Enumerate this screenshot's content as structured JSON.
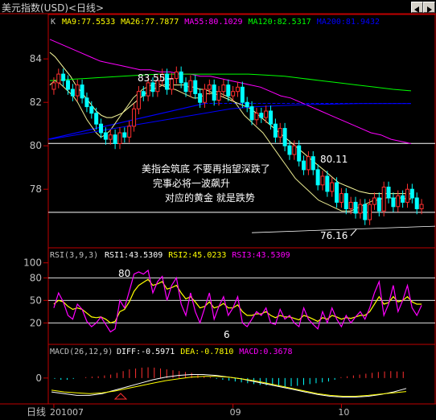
{
  "window": {
    "title": "美元指数(USD)<日线>"
  },
  "chart_data": [
    {
      "type": "candlestick",
      "panel": "main",
      "ma_header": {
        "prefix": "K",
        "items": [
          {
            "text": "MA9:77.5533",
            "color": "#ffff00"
          },
          {
            "text": "MA26:77.7877",
            "color": "#ffff00"
          },
          {
            "text": "MA55:80.1029",
            "color": "#ff00ff"
          },
          {
            "text": "MA120:82.5317",
            "color": "#00ff00"
          },
          {
            "text": "MA200:81.9432",
            "color": "#0000ff"
          }
        ]
      },
      "y_ticks": [
        84,
        82,
        80,
        78
      ],
      "ylim": [
        75.6,
        85.6
      ],
      "hlines": [
        80.11,
        76.94
      ],
      "annotations": {
        "high": "83.55",
        "mid": "80.11",
        "low": "76.16",
        "comment": [
          "美指会筑底 不要再指望深跌了",
          "完事必将一波飙升",
          "对应的黄金 就是跌势"
        ]
      },
      "closes": [
        82.9,
        83.3,
        83.0,
        82.6,
        82.3,
        82.8,
        82.2,
        81.8,
        81.5,
        81.0,
        80.6,
        80.3,
        80.5,
        80.1,
        80.6,
        80.4,
        80.9,
        81.7,
        82.5,
        82.3,
        82.9,
        82.5,
        83.0,
        83.3,
        82.6,
        83.1,
        83.4,
        82.9,
        82.5,
        83.0,
        82.4,
        82.0,
        82.6,
        82.8,
        82.1,
        82.5,
        82.8,
        82.3,
        82.5,
        82.7,
        82.0,
        81.8,
        81.2,
        81.5,
        81.3,
        81.6,
        81.0,
        80.4,
        80.8,
        80.0,
        79.6,
        80.0,
        79.3,
        78.9,
        79.5,
        78.9,
        78.2,
        78.6,
        77.9,
        78.3,
        77.4,
        77.8,
        77.1,
        77.4,
        76.9,
        77.3,
        76.6,
        77.3,
        77.6,
        77.0,
        78.1,
        77.6,
        77.2,
        77.7,
        77.4,
        78.0,
        77.6,
        77.1,
        77.3
      ],
      "ma_series": [
        {
          "name": "MA9",
          "color": "#e8e890",
          "values": [
            82.8,
            83.0,
            82.9,
            82.7,
            82.5,
            82.3,
            82.0,
            81.6,
            81.2,
            80.9,
            80.6,
            80.4,
            80.5,
            80.7,
            81.0,
            81.3,
            81.6,
            81.9,
            82.2,
            82.4,
            82.6,
            82.7,
            82.8,
            82.9,
            82.8,
            82.7,
            82.6,
            82.6,
            82.5,
            82.4,
            82.3,
            82.2,
            82.2,
            82.3,
            82.4,
            82.4,
            82.5,
            82.4,
            82.3,
            82.2,
            82.0,
            81.7,
            81.4,
            81.2,
            81.0,
            80.8,
            80.6,
            80.3,
            80.0,
            79.7,
            79.4,
            79.1,
            78.8,
            78.5,
            78.3,
            78.1,
            77.9,
            77.7,
            77.5,
            77.4,
            77.3,
            77.2,
            77.1,
            77.0,
            77.0,
            77.0,
            77.1,
            77.2,
            77.3,
            77.4,
            77.5,
            77.5,
            77.6,
            77.6,
            77.6,
            77.6,
            77.6,
            77.55,
            77.55
          ]
        },
        {
          "name": "MA26",
          "color": "#ffffa0",
          "values": [
            84.3,
            84.1,
            83.8,
            83.5,
            83.2,
            82.8,
            82.5,
            82.2,
            81.9,
            81.6,
            81.4,
            81.3,
            81.3,
            81.4,
            81.5,
            81.7,
            81.9,
            82.1,
            82.3,
            82.5,
            82.6,
            82.7,
            82.8,
            82.8,
            82.8,
            82.8,
            82.8,
            82.7,
            82.7,
            82.6,
            82.6,
            82.5,
            82.4,
            82.3,
            82.2,
            82.1,
            82.0,
            81.9,
            81.8,
            81.7,
            81.5,
            81.3,
            81.1,
            80.9,
            80.7,
            80.5,
            80.3,
            80.1,
            79.9,
            79.7,
            79.5,
            79.3,
            79.1,
            78.9,
            78.7,
            78.5,
            78.3,
            78.2,
            78.1,
            78.0,
            77.9,
            77.85,
            77.8,
            77.8,
            77.8,
            77.8,
            77.8,
            77.8,
            77.8,
            77.8,
            77.79
          ]
        },
        {
          "name": "MA55",
          "color": "#ff00ff",
          "values": [
            84.9,
            84.7,
            84.5,
            84.3,
            84.1,
            83.9,
            83.8,
            83.7,
            83.6,
            83.5,
            83.5,
            83.4,
            83.4,
            83.3,
            83.3,
            83.2,
            83.2,
            83.1,
            83.0,
            82.9,
            82.8,
            82.7,
            82.5,
            82.3,
            82.2,
            82.0,
            81.8,
            81.6,
            81.4,
            81.2,
            81.0,
            80.8,
            80.6,
            80.5,
            80.3,
            80.2,
            80.1
          ]
        },
        {
          "name": "MA120",
          "color": "#00ff00",
          "values": [
            83.0,
            83.05,
            83.1,
            83.15,
            83.2,
            83.25,
            83.3,
            83.3,
            83.3,
            83.3,
            83.3,
            83.3,
            83.25,
            83.2,
            83.1,
            83.0,
            82.9,
            82.8,
            82.7,
            82.6,
            82.53
          ]
        },
        {
          "name": "MA200",
          "color": "#0000ff",
          "values": [
            80.3,
            80.5,
            80.7,
            80.9,
            81.1,
            81.3,
            81.5,
            81.7,
            81.8,
            81.85,
            81.9,
            81.92,
            81.94,
            81.94,
            81.94
          ]
        }
      ]
    },
    {
      "type": "line",
      "panel": "RSI",
      "header": {
        "prefix": "RSI(3,9,3)",
        "items": [
          {
            "text": "RSI1:43.5309",
            "color": "#ffffff"
          },
          {
            "text": "RSI2:45.0233",
            "color": "#ffff00"
          },
          {
            "text": "RSI3:43.5309",
            "color": "#ff00ff"
          }
        ]
      },
      "y_ticks": [
        100,
        80,
        50,
        20
      ],
      "ylim": [
        0,
        105
      ],
      "hlines": [
        80,
        50,
        20
      ],
      "annotations": {
        "high": "80",
        "low": "6"
      },
      "series": [
        {
          "name": "RSI1",
          "color": "#ff00ff",
          "values": [
            40,
            60,
            48,
            30,
            25,
            45,
            38,
            22,
            15,
            20,
            28,
            18,
            8,
            12,
            50,
            40,
            62,
            85,
            88,
            85,
            90,
            60,
            75,
            82,
            50,
            70,
            80,
            45,
            30,
            60,
            35,
            20,
            40,
            60,
            25,
            42,
            55,
            30,
            40,
            55,
            20,
            15,
            25,
            35,
            30,
            40,
            20,
            18,
            38,
            25,
            30,
            20,
            15,
            40,
            25,
            18,
            12,
            35,
            20,
            40,
            25,
            15,
            30,
            20,
            28,
            35,
            25,
            40,
            60,
            75,
            30,
            45,
            70,
            35,
            50,
            70,
            40,
            30,
            43.5
          ]
        },
        {
          "name": "RSI2",
          "color": "#ffff00",
          "values": [
            45,
            50,
            48,
            42,
            38,
            40,
            38,
            33,
            28,
            27,
            28,
            25,
            20,
            22,
            35,
            38,
            48,
            62,
            70,
            74,
            78,
            70,
            72,
            75,
            65,
            67,
            70,
            60,
            52,
            55,
            48,
            40,
            42,
            48,
            40,
            42,
            46,
            40,
            40,
            44,
            35,
            30,
            30,
            32,
            32,
            35,
            30,
            27,
            30,
            28,
            28,
            26,
            24,
            30,
            28,
            25,
            22,
            27,
            25,
            30,
            28,
            25,
            27,
            26,
            28,
            30,
            30,
            35,
            45,
            55,
            45,
            47,
            55,
            48,
            50,
            55,
            48,
            45,
            45
          ]
        }
      ]
    },
    {
      "type": "bar",
      "panel": "MACD",
      "header": {
        "prefix": "MACD(26,12,9)",
        "items": [
          {
            "text": "DIFF:-0.5971",
            "color": "#ffffff"
          },
          {
            "text": "DEA:-0.7810",
            "color": "#ffff00"
          },
          {
            "text": "MACD:0.3678",
            "color": "#ff00ff"
          }
        ]
      },
      "y_ticks": [
        0
      ],
      "ylim": [
        -1.4,
        1.2
      ],
      "macd": [
        -0.05,
        -0.1,
        -0.1,
        -0.05,
        0,
        0.05,
        0.08,
        0.1,
        0.15,
        0.2,
        0.3,
        0.4,
        0.5,
        0.55,
        0.6,
        0.62,
        0.6,
        0.55,
        0.5,
        0.45,
        0.4,
        0.35,
        0.3,
        0.2,
        0.1,
        0.05,
        -0.05,
        -0.1,
        -0.15,
        -0.2,
        -0.25,
        -0.3,
        -0.35,
        -0.4,
        -0.42,
        -0.45,
        -0.48,
        -0.5,
        -0.48,
        -0.45,
        -0.4,
        -0.35,
        -0.3,
        -0.25,
        -0.2,
        -0.1,
        0.05,
        0.1,
        0.15,
        0.2,
        0.25,
        0.3,
        0.35,
        0.38,
        0.4,
        0.38,
        0.37
      ],
      "diff": [
        -0.8,
        -0.9,
        -1.0,
        -1.0,
        -0.9,
        -0.7,
        -0.5,
        -0.3,
        -0.1,
        0.05,
        0.15,
        0.2,
        0.2,
        0.15,
        0.05,
        -0.05,
        -0.2,
        -0.35,
        -0.5,
        -0.65,
        -0.8,
        -0.95,
        -1.05,
        -1.1,
        -1.1,
        -1.05,
        -0.95,
        -0.8,
        -0.6
      ],
      "dea": [
        -0.7,
        -0.8,
        -0.85,
        -0.9,
        -0.85,
        -0.75,
        -0.6,
        -0.45,
        -0.3,
        -0.15,
        -0.05,
        0.05,
        0.1,
        0.1,
        0.05,
        -0.05,
        -0.15,
        -0.3,
        -0.45,
        -0.6,
        -0.75,
        -0.9,
        -1.0,
        -1.05,
        -1.05,
        -1.0,
        -0.92,
        -0.85,
        -0.78
      ]
    }
  ],
  "x_axis": {
    "label": "日线",
    "ticks": [
      "201007",
      "09",
      "10"
    ],
    "tick_index": [
      0,
      38,
      61
    ]
  }
}
